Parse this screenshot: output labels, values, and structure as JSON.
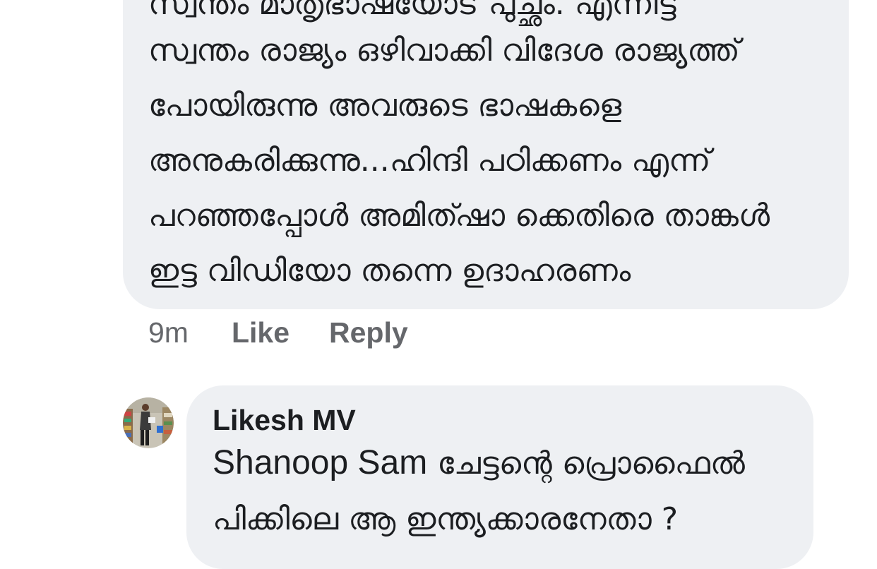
{
  "comment1": {
    "lines": [
      "സ്വന്തം മാതൃഭാഷയോട് പുച്ഛം. എന്നിട്ട്",
      "സ്വന്തം രാജ്യം ഒഴിവാക്കി വിദേശ രാജ്യത്ത്",
      "പോയിരുന്നു അവരുടെ ഭാഷകളെ",
      "അനുകരിക്കുന്നു...ഹിന്ദി പഠിക്കണം എന്ന്",
      "പറഞ്ഞപ്പോൾ അമിത്ഷാ ക്കെതിരെ താങ്കൾ",
      "ഇട്ട വിഡിയോ തന്നെ ഉദാഹരണം"
    ],
    "time": "9m",
    "like_label": "Like",
    "reply_label": "Reply"
  },
  "comment2": {
    "author": "Likesh MV",
    "mention": "Shanoop Sam",
    "line1_rest": " ചേട്ടന്റെ പ്രൊഫൈൽ",
    "line2": "പിക്കിലെ ആ ഇന്ത്യക്കാരനേതാ ?"
  }
}
